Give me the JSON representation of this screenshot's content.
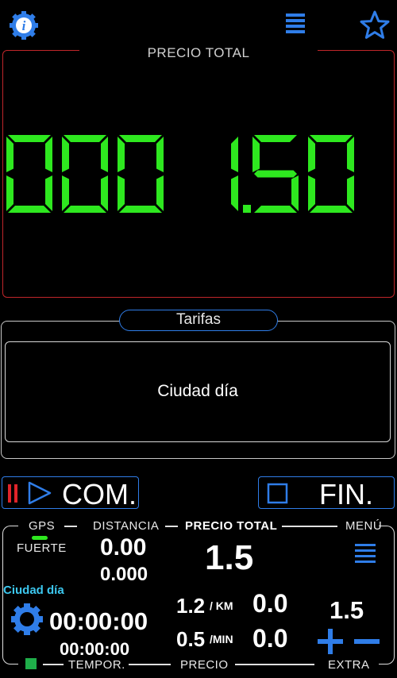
{
  "meter": {
    "title": "PRECIO TOTAL",
    "display": "000 1.50",
    "digit_color": "#2ee81f"
  },
  "tarifas": {
    "label": "Tarifas",
    "current": "Ciudad día"
  },
  "buttons": {
    "start": "COM.",
    "stop": "FIN."
  },
  "bottom": {
    "gps_label": "GPS",
    "gps_signal": "FUERTE",
    "distancia_label": "DISTANCIA",
    "distancia_value": "0.00",
    "distancia_sub": "0.000",
    "precio_total_label": "PRECIO TOTAL",
    "precio_total_value": "1.5",
    "menu_label": "MENÚ",
    "tarifa_name": "Ciudad día",
    "time_main": "00:00:00",
    "time_sub": "00:00:00",
    "rate_km": "1.2",
    "rate_km_unit": "/ KM",
    "rate_min": "0.5",
    "rate_min_unit": "/MIN",
    "precio_km_value": "0.0",
    "precio_min_value": "0.0",
    "extra_value": "1.5",
    "tempor_label": "TEMPOR.",
    "precio_label": "PRECIO",
    "extra_label": "EXTRA"
  },
  "colors": {
    "accent": "#2f7de8",
    "meter_border": "#c0262a",
    "digits": "#2ee81f",
    "tarifa_text": "#3cc8f0",
    "pause": "#e0242a",
    "gps_good": "#2ee81f"
  },
  "icons": {
    "info": "info-gear-icon",
    "menu": "menu-lines-icon",
    "favorite": "star-icon",
    "settings": "gear-icon",
    "plus": "plus-icon",
    "minus": "minus-icon",
    "pause": "pause-icon",
    "play": "play-icon",
    "stop": "stop-icon"
  }
}
